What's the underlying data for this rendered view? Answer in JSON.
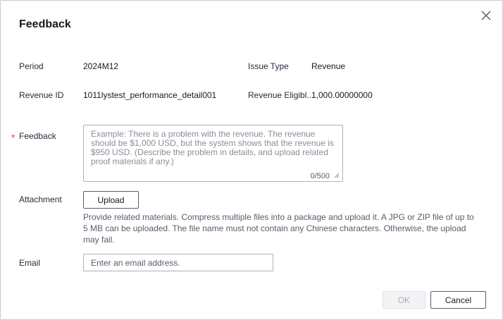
{
  "dialog": {
    "title": "Feedback",
    "close_icon": "close-icon"
  },
  "fields": {
    "period": {
      "label": "Period",
      "value": "2024M12"
    },
    "issue_type": {
      "label": "Issue Type",
      "value": "Revenue"
    },
    "revenue_id": {
      "label": "Revenue ID",
      "value": "1011lystest_performance_detail001"
    },
    "revenue_eligible": {
      "label": "Revenue Eligibl...",
      "value": "1,000.00000000"
    },
    "feedback": {
      "required_mark": "*",
      "label": "Feedback",
      "placeholder": "Example: There is a problem with the revenue. The revenue should be $1,000 USD, but the system shows that the revenue is $950 USD. (Describe the problem in details, and upload related proof materials if any.)",
      "counter": "0/500"
    },
    "attachment": {
      "label": "Attachment",
      "button_label": "Upload",
      "help_text": "Provide related materials. Compress multiple files into a package and upload it. A JPG or ZIP file of up to 5 MB can be uploaded. The file name must not contain any Chinese characters. Otherwise, the upload may fail."
    },
    "email": {
      "label": "Email",
      "placeholder": "Enter an email address.",
      "value": ""
    }
  },
  "footer": {
    "ok_label": "OK",
    "cancel_label": "Cancel"
  },
  "colors": {
    "required": "#e8412f",
    "border": "#adb0b8",
    "text": "#191919",
    "muted": "#575d6c",
    "disabled_text": "#adb0b8"
  }
}
